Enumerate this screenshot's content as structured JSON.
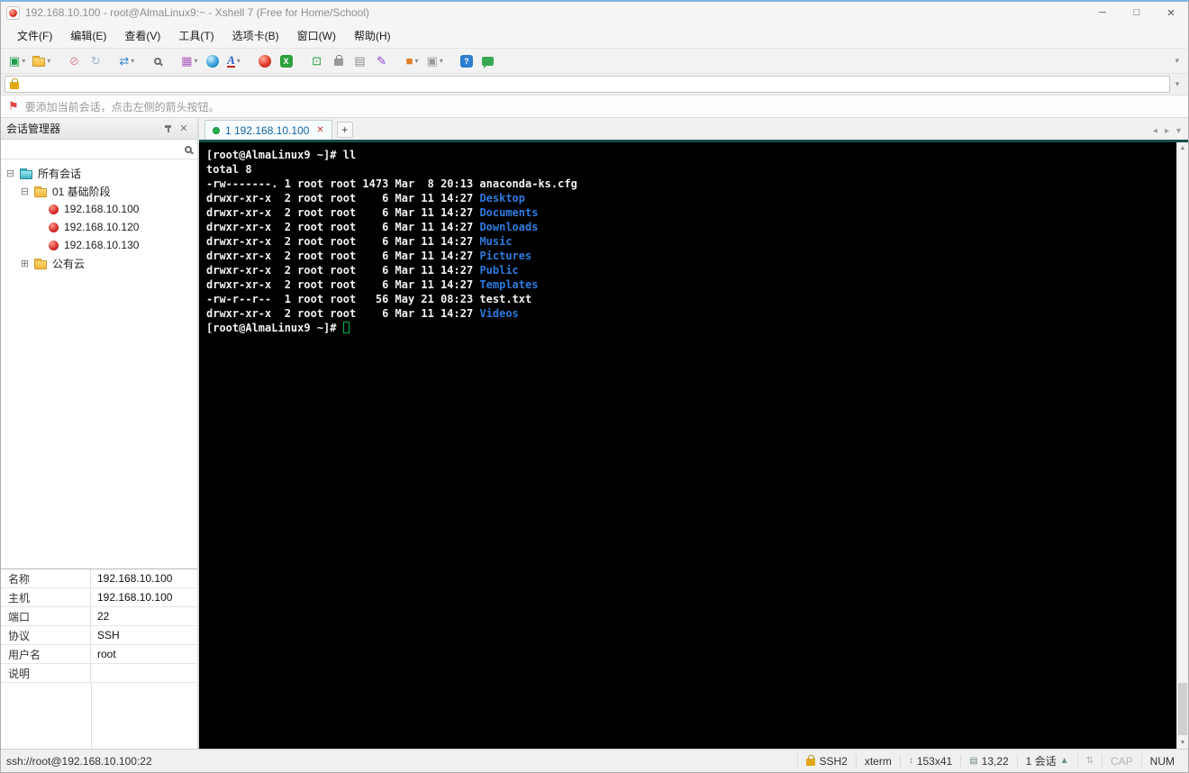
{
  "titlebar": {
    "title": "192.168.10.100 - root@AlmaLinux9:~ - Xshell 7 (Free for Home/School)"
  },
  "icons": {
    "dropdown": "▾",
    "minus": "⊟",
    "plus": "⊞",
    "close": "✕",
    "minimize": "─",
    "maximize": "□",
    "resize": "↕",
    "grid": "▤",
    "caret_up": "▲",
    "scroll_up": "▲",
    "scroll_down": "▼",
    "tab_left": "◂",
    "tab_right": "▸",
    "new_tab": "+",
    "flag": "⚑",
    "arrows": "⇅"
  },
  "menubar": {
    "items": [
      {
        "name": "menu-file",
        "label": "文件(F)"
      },
      {
        "name": "menu-edit",
        "label": "编辑(E)"
      },
      {
        "name": "menu-view",
        "label": "查看(V)"
      },
      {
        "name": "menu-tools",
        "label": "工具(T)"
      },
      {
        "name": "menu-tab",
        "label": "选项卡(B)"
      },
      {
        "name": "menu-window",
        "label": "窗口(W)"
      },
      {
        "name": "menu-help",
        "label": "帮助(H)"
      }
    ]
  },
  "toolbar": {
    "buttons": [
      {
        "name": "new-session-button",
        "kind": "glyph",
        "glyph": "▣",
        "color": "#1f9e4e",
        "dropdown": true
      },
      {
        "name": "open-sessions-button",
        "kind": "folder",
        "dropdown": true
      },
      {
        "name": "disconnect-button",
        "kind": "glyph",
        "glyph": "⊘",
        "color": "#d98c8c",
        "gap": true
      },
      {
        "name": "reconnect-button",
        "kind": "glyph",
        "glyph": "↻",
        "color": "#9ab4cc"
      },
      {
        "name": "file-transfer-dropdown",
        "kind": "glyph",
        "glyph": "⇄",
        "color": "#2d7dd2",
        "dropdown": true,
        "gap": true
      },
      {
        "name": "find-button",
        "kind": "mag",
        "gap": true
      },
      {
        "name": "layout-dropdown",
        "kind": "glyph",
        "glyph": "▦",
        "color": "#b05cc0",
        "dropdown": true,
        "gap": true
      },
      {
        "name": "globe-button",
        "kind": "sphere-blue"
      },
      {
        "name": "font-color-dropdown",
        "kind": "font",
        "glyph": "A",
        "color": "#2d5fc4",
        "dropdown": true
      },
      {
        "name": "xshell-button",
        "kind": "sphere-red",
        "gap": true
      },
      {
        "name": "xftp-button",
        "kind": "badge",
        "glyph": "X",
        "bg": "#2ca03c"
      },
      {
        "name": "fullscreen-button",
        "kind": "glyph",
        "glyph": "⊡",
        "color": "#27a043",
        "gap": true
      },
      {
        "name": "lock-button",
        "kind": "lock"
      },
      {
        "name": "virtual-keyboard-button",
        "kind": "glyph",
        "glyph": "▤",
        "color": "#8d8d8d"
      },
      {
        "name": "highlight-pen-button",
        "kind": "glyph",
        "glyph": "✎",
        "color": "#8a46c8"
      },
      {
        "name": "quick-command-dropdown",
        "kind": "glyph",
        "glyph": "■",
        "color": "#e07b23",
        "dropdown": true,
        "gap": true
      },
      {
        "name": "panes-dropdown",
        "kind": "glyph",
        "glyph": "▣",
        "color": "#9a9a9a",
        "dropdown": true
      },
      {
        "name": "help-button",
        "kind": "badge",
        "glyph": "?",
        "bg": "#2d7dd2",
        "gap": true
      },
      {
        "name": "feedback-button",
        "kind": "bubble"
      }
    ]
  },
  "addressbar": {
    "value": ""
  },
  "infobar": {
    "message": "要添加当前会话，点击左侧的箭头按钮。"
  },
  "sidebar": {
    "title": "会话管理器",
    "tree": [
      {
        "name": "tree-item-all-sessions",
        "level": 0,
        "toggle": "minus",
        "icon": "folder-teal",
        "label": "所有会话"
      },
      {
        "name": "tree-item-folder-basic",
        "level": 1,
        "toggle": "minus",
        "icon": "folder-yellow",
        "label": "01 基础阶段"
      },
      {
        "name": "tree-item-session-100",
        "level": 2,
        "toggle": null,
        "icon": "session",
        "label": "192.168.10.100"
      },
      {
        "name": "tree-item-session-120",
        "level": 2,
        "toggle": null,
        "icon": "session",
        "label": "192.168.10.120"
      },
      {
        "name": "tree-item-session-130",
        "level": 2,
        "toggle": null,
        "icon": "session",
        "label": "192.168.10.130"
      },
      {
        "name": "tree-item-folder-cloud",
        "level": 1,
        "toggle": "plus",
        "icon": "folder-yellow",
        "label": "公有云"
      }
    ],
    "properties": [
      {
        "name": "prop-name",
        "label": "名称",
        "value": "192.168.10.100"
      },
      {
        "name": "prop-host",
        "label": "主机",
        "value": "192.168.10.100"
      },
      {
        "name": "prop-port",
        "label": "端口",
        "value": "22"
      },
      {
        "name": "prop-protocol",
        "label": "协议",
        "value": "SSH"
      },
      {
        "name": "prop-username",
        "label": "用户名",
        "value": "root"
      },
      {
        "name": "prop-description",
        "label": "说明",
        "value": ""
      }
    ]
  },
  "tabbar": {
    "tabs": [
      {
        "name": "tab-session-1",
        "label": "1 192.168.10.100",
        "active": true
      }
    ]
  },
  "terminal": {
    "colors": {
      "background": "#000000",
      "foreground": "#f2f2f2",
      "directory": "#2d7bde",
      "cursor": "#00b44e"
    },
    "lines": [
      {
        "segments": [
          {
            "text": "[root@AlmaLinux9 ~]# ll"
          }
        ]
      },
      {
        "segments": [
          {
            "text": "total 8"
          }
        ]
      },
      {
        "segments": [
          {
            "text": "-rw-------. 1 root root 1473 Mar  8 20:13 anaconda-ks.cfg"
          }
        ]
      },
      {
        "segments": [
          {
            "text": "drwxr-xr-x  2 root root    6 Mar 11 14:27 "
          },
          {
            "text": "Desktop",
            "color": "directory"
          }
        ]
      },
      {
        "segments": [
          {
            "text": "drwxr-xr-x  2 root root    6 Mar 11 14:27 "
          },
          {
            "text": "Documents",
            "color": "directory"
          }
        ]
      },
      {
        "segments": [
          {
            "text": "drwxr-xr-x  2 root root    6 Mar 11 14:27 "
          },
          {
            "text": "Downloads",
            "color": "directory"
          }
        ]
      },
      {
        "segments": [
          {
            "text": "drwxr-xr-x  2 root root    6 Mar 11 14:27 "
          },
          {
            "text": "Music",
            "color": "directory"
          }
        ]
      },
      {
        "segments": [
          {
            "text": "drwxr-xr-x  2 root root    6 Mar 11 14:27 "
          },
          {
            "text": "Pictures",
            "color": "directory"
          }
        ]
      },
      {
        "segments": [
          {
            "text": "drwxr-xr-x  2 root root    6 Mar 11 14:27 "
          },
          {
            "text": "Public",
            "color": "directory"
          }
        ]
      },
      {
        "segments": [
          {
            "text": "drwxr-xr-x  2 root root    6 Mar 11 14:27 "
          },
          {
            "text": "Templates",
            "color": "directory"
          }
        ]
      },
      {
        "segments": [
          {
            "text": "-rw-r--r--  1 root root   56 May 21 08:23 test.txt"
          }
        ]
      },
      {
        "segments": [
          {
            "text": "drwxr-xr-x  2 root root    6 Mar 11 14:27 "
          },
          {
            "text": "Videos",
            "color": "directory"
          }
        ]
      },
      {
        "segments": [
          {
            "text": "[root@AlmaLinux9 ~]# "
          }
        ],
        "cursor": true
      }
    ]
  },
  "statusbar": {
    "left": "ssh://root@192.168.10.100:22",
    "items": [
      {
        "name": "status-encryption",
        "icon": "lock",
        "text": "SSH2",
        "clickable": false
      },
      {
        "name": "status-terminal-type",
        "text": "xterm",
        "clickable": false
      },
      {
        "name": "status-screen-size",
        "icon": "resize",
        "text": "153x41",
        "clickable": false
      },
      {
        "name": "status-cursor-position",
        "icon": "grid",
        "text": "13,22",
        "clickable": false
      },
      {
        "name": "status-session-count",
        "text": "1 会话",
        "caret": true,
        "clickable": true
      },
      {
        "name": "status-scroll-buttons",
        "icon": "arrows",
        "clickable": true,
        "muted": true
      },
      {
        "name": "status-caps-lock",
        "text": "CAP",
        "muted": true,
        "clickable": false
      },
      {
        "name": "status-num-lock",
        "text": "NUM",
        "clickable": false
      }
    ]
  }
}
